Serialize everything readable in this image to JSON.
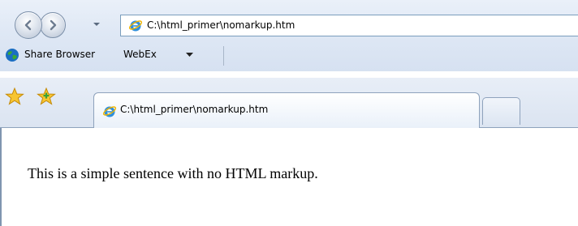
{
  "navigation": {
    "back_icon": "back-arrow-icon",
    "forward_icon": "forward-arrow-icon",
    "history_icon": "chevron-down-icon"
  },
  "address_bar": {
    "value": "C:\\html_primer\\nomarkup.htm",
    "page_icon": "internet-explorer-icon"
  },
  "links_bar": {
    "items": [
      {
        "label": "Share Browser",
        "icon": "globe-icon"
      },
      {
        "label": "WebEx",
        "icon": "chevron-down-icon"
      }
    ]
  },
  "tabs": {
    "favorites_icon": "star-icon",
    "add_favorites_icon": "add-favorites-icon",
    "items": [
      {
        "label": "C:\\html_primer\\nomarkup.htm",
        "icon": "internet-explorer-icon",
        "active": true
      }
    ],
    "new_tab_icon": "new-tab-icon"
  },
  "page": {
    "body_text": "This is a simple sentence with no HTML markup."
  },
  "colors": {
    "chrome_background": "#dfe8f5",
    "border": "#7b9ebd",
    "tab_active": "#ffffff"
  }
}
